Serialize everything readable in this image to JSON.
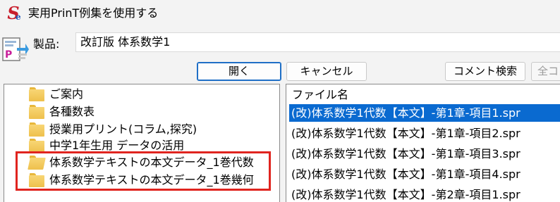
{
  "window": {
    "title": "実用PrinT例集を使用する",
    "app_icon_letter": "S",
    "app_icon_sub": "e"
  },
  "product": {
    "label": "製品:",
    "value": "改訂版 体系数学1"
  },
  "buttons": {
    "open": "開く",
    "cancel": "キャンセル",
    "comment_search": "コメント検索",
    "full_comment": "全コメ"
  },
  "tree": {
    "items": [
      "ご案内",
      "各種数表",
      "授業用プリント(コラム,探究)",
      "中学1年生用 データの活用",
      "体系数学テキストの本文データ_1巻代数",
      "体系数学テキストの本文データ_1巻幾何"
    ]
  },
  "list": {
    "header": "ファイル名",
    "rows": [
      "(改)体系数学1代数【本文】-第1章-項目1.spr",
      "(改)体系数学1代数【本文】-第1章-項目2.spr",
      "(改)体系数学1代数【本文】-第1章-項目3.spr",
      "(改)体系数学1代数【本文】-第1章-項目4.spr",
      "(改)体系数学1代数【本文】-第2章-項目1.spr"
    ],
    "selected_index": 0
  },
  "colors": {
    "selection": "#0a6ad0",
    "highlight_box": "#e0241f",
    "primary_button_border": "#1f6fc6"
  }
}
